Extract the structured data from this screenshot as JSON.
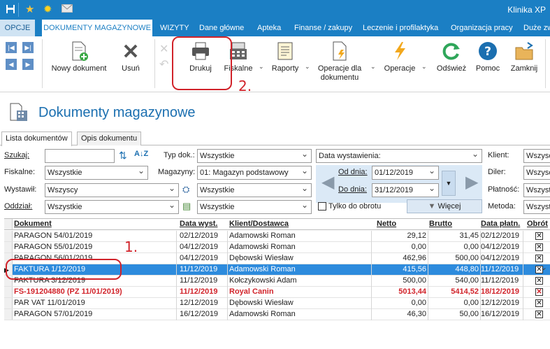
{
  "app": {
    "title": "Klinika XP"
  },
  "menu": {
    "tabs": [
      "OPCJE",
      "DOKUMENTY MAGAZYNOWE",
      "WIZYTY",
      "Dane główne",
      "Apteka",
      "Finanse / zakupy",
      "Leczenie i profilaktyka",
      "Organizacja pracy",
      "Duże zw"
    ]
  },
  "ribbon": {
    "new_doc": "Nowy dokument",
    "delete": "Usuń",
    "print": "Drukuj",
    "fiscal": "Fiskalne",
    "reports": "Raporty",
    "ops_doc_line1": "Operacje dla",
    "ops_doc_line2": "dokumentu",
    "ops": "Operacje",
    "refresh": "Odśwież",
    "help": "Pomoc",
    "close": "Zamknij"
  },
  "annotations": {
    "one": "1.",
    "two": "2."
  },
  "page": {
    "title": "Dokumenty magazynowe"
  },
  "subtabs": [
    "Lista dokumentów",
    "Opis dokumentu"
  ],
  "filters": {
    "search_label": "Szukaj:",
    "search_value": "",
    "fiscal_label": "Fiskalne:",
    "fiscal_value": "Wszystkie",
    "issued_by_label": "Wystawił:",
    "issued_by_value": "Wszyscy",
    "branch_label": "Oddział:",
    "branch_value": "Wszystkie",
    "doc_type_label": "Typ dok.:",
    "doc_type_value": "Wszystkie",
    "warehouse_label": "Magazyny:",
    "warehouse_value": "01: Magazyn podstawowy",
    "extra1_value": "Wszystkie",
    "extra2_value": "Wszystkie",
    "date_field_value": "Data wystawienia:",
    "from_label": "Od dnia:",
    "from_value": "01/12/2019",
    "to_label": "Do dnia:",
    "to_value": "31/12/2019",
    "turnover_only": "Tylko do obrotu",
    "more_button": "Więcej",
    "client_label": "Klient:",
    "client_value": "Wszysc",
    "dealer_label": "Diler:",
    "dealer_value": "Wszysc",
    "payment_label": "Płatność:",
    "payment_value": "Wszyst",
    "method_label": "Metoda:",
    "method_value": "Wszyst"
  },
  "table": {
    "columns": [
      "Dokument",
      "Data wyst.",
      "Klient/Dostawca",
      "Netto",
      "Brutto",
      "Data płatn.",
      "Obrót"
    ],
    "rows": [
      {
        "doc": "PARAGON 54/01/2019",
        "date": "02/12/2019",
        "client": "Adamowski Roman",
        "net": "29,12",
        "gross": "31,45",
        "pay": "02/12/2019",
        "state": "normal"
      },
      {
        "doc": "PARAGON 55/01/2019",
        "date": "04/12/2019",
        "client": "Adamowski Roman",
        "net": "0,00",
        "gross": "0,00",
        "pay": "04/12/2019",
        "state": "normal"
      },
      {
        "doc": "PARAGON 56/01/2019",
        "date": "04/12/2019",
        "client": "Dębowski Wiesław",
        "net": "462,96",
        "gross": "500,00",
        "pay": "04/12/2019",
        "state": "normal"
      },
      {
        "doc": "FAKTURA 1/12/2019",
        "date": "11/12/2019",
        "client": "Adamowski Roman",
        "net": "415,56",
        "gross": "448,80",
        "pay": "11/12/2019",
        "state": "selected"
      },
      {
        "doc": "FAKTURA 3/12/2019",
        "date": "11/12/2019",
        "client": "Kołczykowski Adam",
        "net": "500,00",
        "gross": "540,00",
        "pay": "11/12/2019",
        "state": "normal"
      },
      {
        "doc": "FS-191204880 (PZ 11/01/2019)",
        "date": "11/12/2019",
        "client": "Royal Canin",
        "net": "5013,44",
        "gross": "5414,52",
        "pay": "18/12/2019",
        "state": "red"
      },
      {
        "doc": "PAR VAT 11/01/2019",
        "date": "12/12/2019",
        "client": "Dębowski Wiesław",
        "net": "0,00",
        "gross": "0,00",
        "pay": "12/12/2019",
        "state": "normal"
      },
      {
        "doc": "PARAGON 57/01/2019",
        "date": "16/12/2019",
        "client": "Adamowski Roman",
        "net": "46,30",
        "gross": "50,00",
        "pay": "16/12/2019",
        "state": "normal"
      }
    ]
  },
  "colors": {
    "accent": "#1b7fc4",
    "selected_row": "#2d8bdd",
    "annotation": "#d1232a"
  }
}
